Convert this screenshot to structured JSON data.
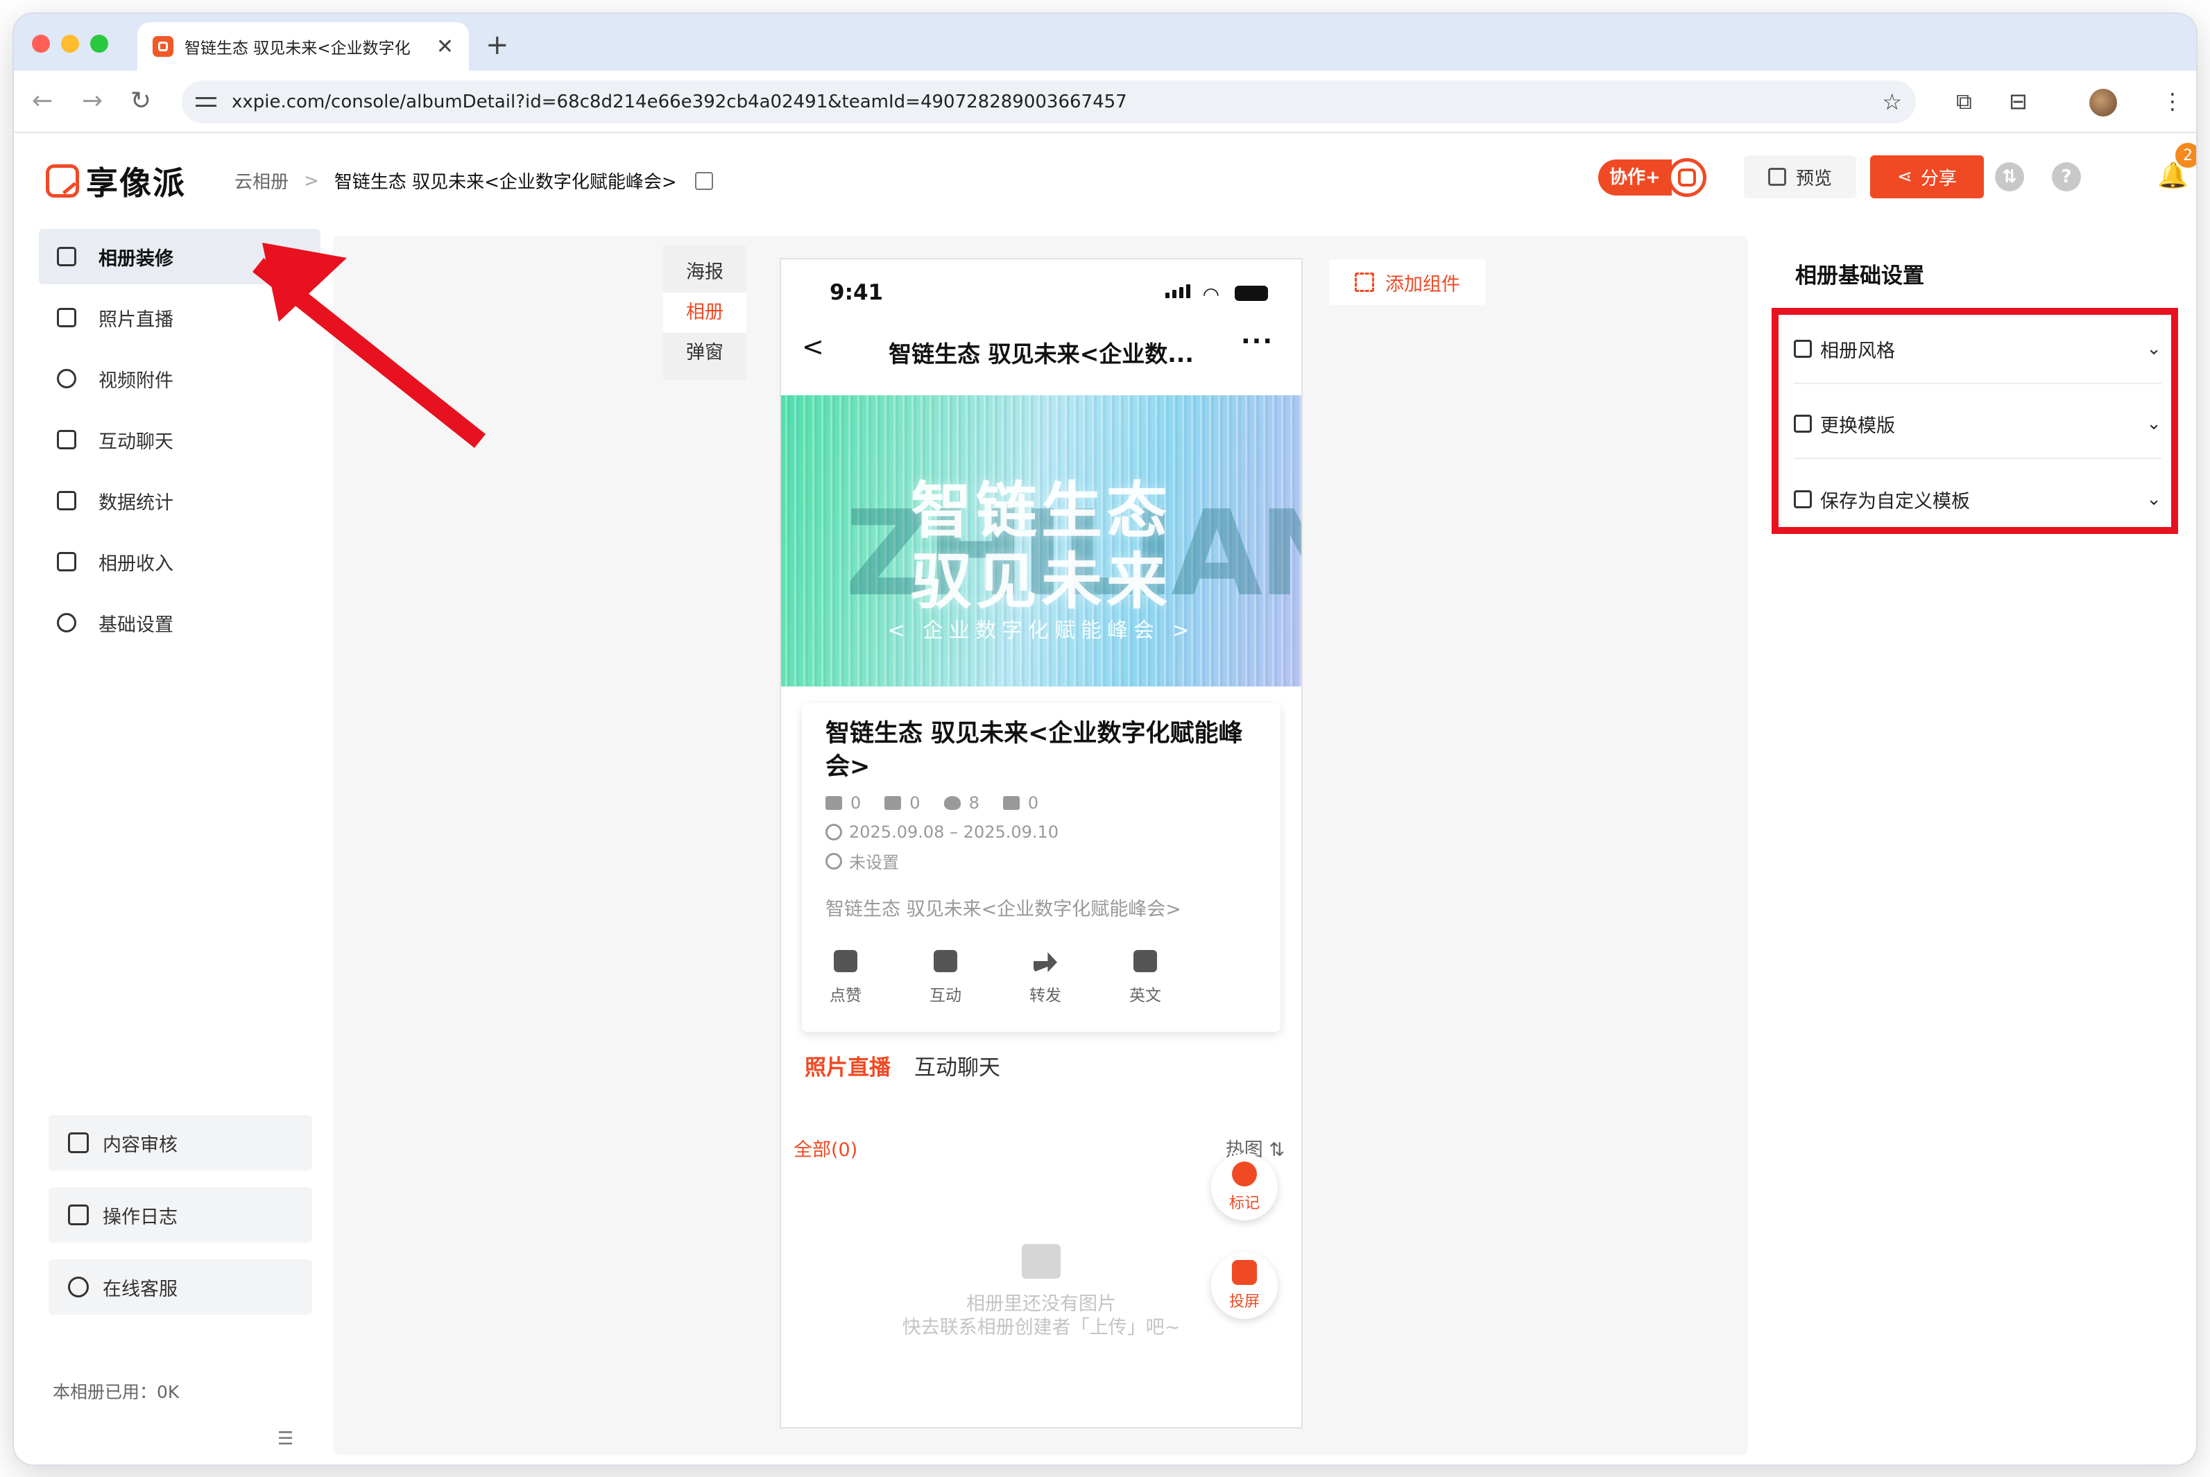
{
  "browser": {
    "tab_title": "智链生态 驭见未来<企业数字化",
    "tab_close": "✕",
    "new_tab": "+",
    "url": "xxpie.com/console/albumDetail?id=68c8d214e66e392cb4a02491&teamId=490728289003667457",
    "back": "←",
    "forward": "→",
    "reload": "↻",
    "star": "☆",
    "menu": "⋮"
  },
  "app": {
    "logo_name": "享像派",
    "breadcrumb": {
      "root": "云相册",
      "separator": ">",
      "current": "智链生态 驭见未来<企业数字化赋能峰会>"
    },
    "collab_label": "协作+",
    "preview_label": "预览",
    "share_label": "分享",
    "help_glyph": "?",
    "notif_count": "2",
    "accent": "#f04a24"
  },
  "sidebar": {
    "items": [
      {
        "label": "相册装修",
        "icon": "decorate-icon"
      },
      {
        "label": "照片直播",
        "icon": "photo-icon"
      },
      {
        "label": "视频附件",
        "icon": "paperclip-icon"
      },
      {
        "label": "互动聊天",
        "icon": "chat-icon"
      },
      {
        "label": "数据统计",
        "icon": "stats-icon"
      },
      {
        "label": "相册收入",
        "icon": "wallet-icon"
      },
      {
        "label": "基础设置",
        "icon": "gear-icon"
      }
    ],
    "bottom_buttons": [
      {
        "label": "内容审核",
        "icon": "review-icon"
      },
      {
        "label": "操作日志",
        "icon": "log-icon"
      },
      {
        "label": "在线客服",
        "icon": "headset-icon"
      }
    ],
    "usage": "本相册已用：0K",
    "collapse_glyph": "☰"
  },
  "editor": {
    "vtabs": [
      "海报",
      "相册",
      "弹窗"
    ],
    "active_vtab": "相册",
    "add_component": "添加组件"
  },
  "phone": {
    "time": "9:41",
    "wifi": "◠",
    "title": "智链生态 驭见未来<企业数...",
    "back": "<",
    "more": "···",
    "banner": {
      "line1": "智链生态",
      "line2": "驭见未来",
      "sub": "< 企业数字化赋能峰会 >",
      "ghost": "ZHILIAN"
    },
    "card": {
      "title": "智链生态 驭见未来<企业数字化赋能峰会>",
      "stats": [
        "0",
        "0",
        "8",
        "0"
      ],
      "date": "2025.09.08 – 2025.09.10",
      "location": "未设置",
      "description": "智链生态 驭见未来<企业数字化赋能峰会>",
      "actions": [
        "点赞",
        "互动",
        "转发",
        "英文"
      ]
    },
    "section_tabs": [
      "照片直播",
      "互动聊天"
    ],
    "filter_all": "全部(0)",
    "sort_label": "热图 ⇅",
    "fab_mark": "标记",
    "fab_cast": "投屏",
    "empty_line1": "相册里还没有图片",
    "empty_line2": "快去联系相册创建者「上传」吧~"
  },
  "right_panel": {
    "title": "相册基础设置",
    "rows": [
      {
        "label": "相册风格",
        "icon": "style-icon"
      },
      {
        "label": "更换模版",
        "icon": "template-icon"
      },
      {
        "label": "保存为自定义模板",
        "icon": "save-icon"
      }
    ],
    "chevron": "⌄",
    "highlight_color": "#e8111f"
  }
}
